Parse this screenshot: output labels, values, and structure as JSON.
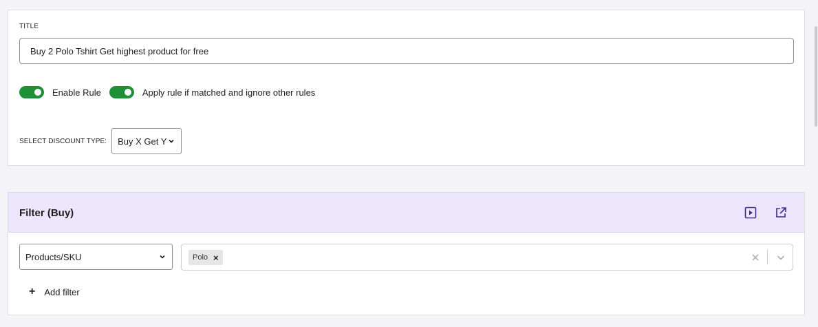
{
  "general": {
    "title_label": "TITLE",
    "title_value": "Buy 2 Polo Tshirt Get highest product for free",
    "toggles": [
      {
        "label": "Enable Rule",
        "on": true
      },
      {
        "label": "Apply rule if matched and ignore other rules",
        "on": true
      }
    ],
    "discount_type_label": "SELECT DISCOUNT TYPE:",
    "discount_type_value": "Buy X Get Y"
  },
  "filter": {
    "title": "Filter (Buy)",
    "type_value": "Products/SKU",
    "selected_tags": [
      "Polo"
    ],
    "add_filter_label": "Add filter"
  },
  "colors": {
    "toggle_on": "#1e9038",
    "filter_header_bg": "#ebe6fb",
    "icon_accent": "#3c2b8f"
  },
  "icons": {
    "play": "play-square-icon",
    "external": "external-link-icon",
    "chevron": "chevron-down-icon",
    "clear": "close-icon",
    "plus": "plus-icon"
  }
}
